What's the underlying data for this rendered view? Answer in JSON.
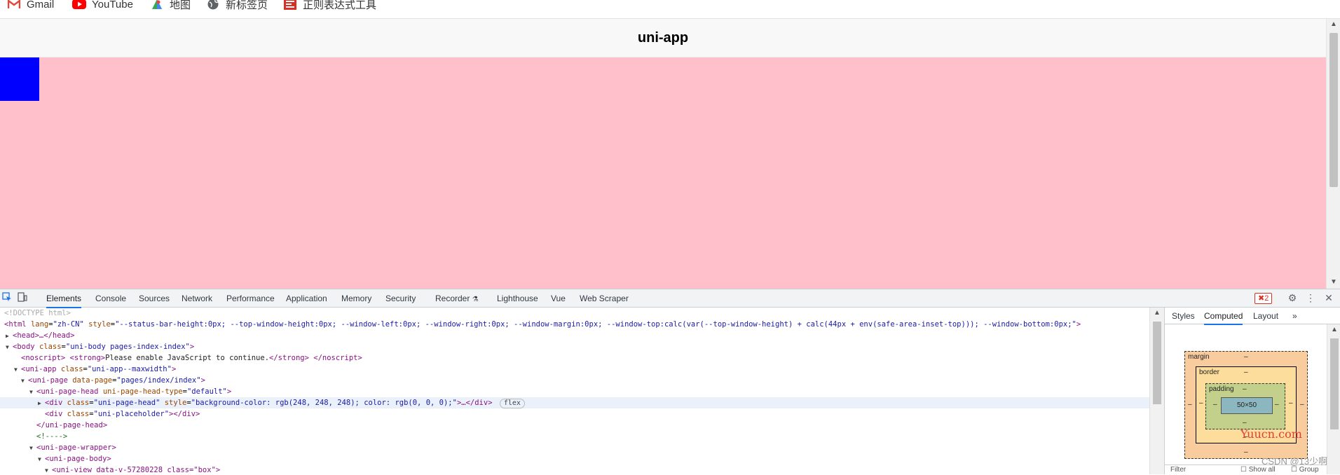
{
  "bookmarks": [
    {
      "label": "Gmail",
      "icon": "gmail-icon"
    },
    {
      "label": "YouTube",
      "icon": "youtube-icon"
    },
    {
      "label": "地图",
      "icon": "maps-icon"
    },
    {
      "label": "新标签页",
      "icon": "globe-icon"
    },
    {
      "label": "正则表达式工具",
      "icon": "regex-icon"
    }
  ],
  "page": {
    "nav_title": "uni-app",
    "background": "#ffc0cb",
    "box_color": "#0000ff"
  },
  "devtools": {
    "tabs": [
      "Elements",
      "Console",
      "Sources",
      "Network",
      "Performance",
      "Application",
      "Memory",
      "Security",
      "Recorder",
      "Lighthouse",
      "Vue",
      "Web Scraper"
    ],
    "active_tab": "Elements",
    "error_count": "2",
    "dom": {
      "doctype": "<!DOCTYPE html>",
      "html_open": "<html",
      "html_attr_lang": "lang",
      "html_val_lang": "\"zh-CN\"",
      "html_attr_style": "style",
      "html_val_style": "\"--status-bar-height:0px; --top-window-height:0px; --window-left:0px; --window-right:0px; --window-margin:0px; --window-top:calc(var(--top-window-height) + calc(44px + env(safe-area-inset-top))); --window-bottom:0px;\"",
      "head": "<head>…</head>",
      "body_open": "<body",
      "body_attr": "class",
      "body_val": "\"uni-body pages-index-index\"",
      "noscript_open": "<noscript>",
      "noscript_strong_open": "<strong>",
      "noscript_text": "Please enable JavaScript to continue.",
      "noscript_strong_close": "</strong>",
      "noscript_close": "</noscript>",
      "app_open": "<uni-app",
      "app_attr": "class",
      "app_val": "\"uni-app--maxwidth\"",
      "page_open": "<uni-page",
      "page_attr": "data-page",
      "page_val": "\"pages/index/index\"",
      "pagehead_open": "<uni-page-head",
      "pagehead_attr": "uni-page-head-type",
      "pagehead_val": "\"default\"",
      "div_open": "<div",
      "div_attr_class": "class",
      "div_val_class": "\"uni-page-head\"",
      "div_attr_style": "style",
      "div_val_style": "\"background-color: rgb(248, 248, 248); color: rgb(0, 0, 0);\"",
      "div_rest": ">…</div>",
      "flex_badge": "flex",
      "placeholder_open": "<div",
      "placeholder_attr": "class",
      "placeholder_val": "\"uni-placeholder\"",
      "placeholder_close": "></div>",
      "pagehead_close": "</uni-page-head>",
      "comment": "<!---->",
      "wrapper_open": "<uni-page-wrapper>",
      "pagebody_open": "<uni-page-body>",
      "view_open": "<uni-view data-v-57280228 class=\"box\">"
    }
  },
  "sidebar": {
    "tabs": [
      "Styles",
      "Computed",
      "Layout"
    ],
    "active_tab": "Computed",
    "more": "»",
    "box_model": {
      "margin_label": "margin",
      "border_label": "border",
      "padding_label": "padding",
      "content": "50×50",
      "dash": "–"
    },
    "filter_label": "Filter",
    "show_all_label": "Show all",
    "group_label": "Group"
  },
  "watermarks": {
    "site": "Yuucn.com",
    "csdn": "CSDN @13少啊"
  }
}
